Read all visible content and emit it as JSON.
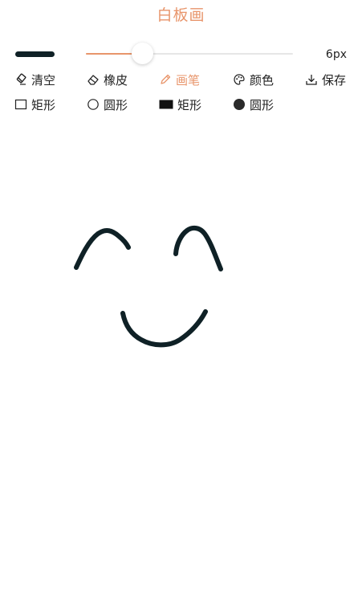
{
  "header": {
    "title": "白板画"
  },
  "brush": {
    "size_label": "6px",
    "slider_fraction": 0.27,
    "preview_color": "#0f2126"
  },
  "toolbar": {
    "row1": [
      {
        "label": "清空",
        "icon": "clear-icon"
      },
      {
        "label": "橡皮",
        "icon": "eraser-icon"
      },
      {
        "label": "画笔",
        "icon": "pencil-icon",
        "active": true
      },
      {
        "label": "颜色",
        "icon": "palette-icon"
      },
      {
        "label": "保存",
        "icon": "download-icon"
      }
    ],
    "row2": [
      {
        "label": "矩形",
        "icon": "rectangle-outline-icon"
      },
      {
        "label": "圆形",
        "icon": "circle-outline-icon"
      },
      {
        "label": "矩形",
        "icon": "rectangle-filled-icon"
      },
      {
        "label": "圆形",
        "icon": "circle-filled-icon"
      }
    ]
  },
  "colors": {
    "accent": "#e8956b",
    "ink": "#0f2126"
  }
}
